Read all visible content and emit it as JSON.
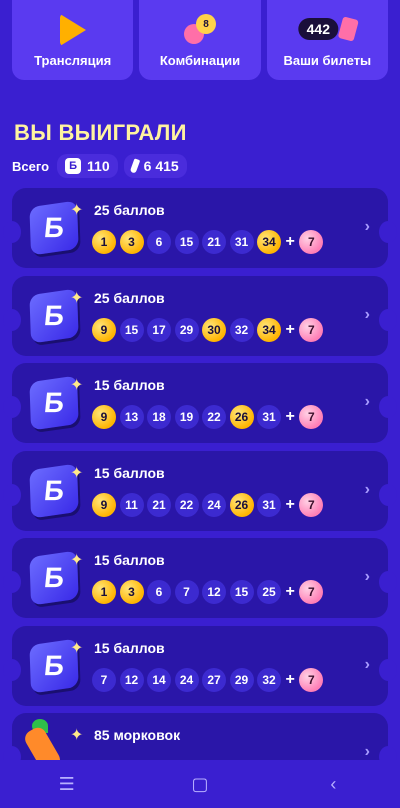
{
  "top_tabs": [
    {
      "label": "Трансляция",
      "icon": "play-icon"
    },
    {
      "label": "Комбинации",
      "icon": "lottery-balls-icon",
      "ball_number": "8"
    },
    {
      "label": "Ваши билеты",
      "icon": "tickets-icon",
      "count": "442"
    }
  ],
  "section_title": "ВЫ ВЫИГРАЛИ",
  "totals": {
    "label": "Всего",
    "points_icon": "Б",
    "points": "110",
    "carrots": "6 415"
  },
  "colors": {
    "background": "#3a1fd0",
    "card": "#2a16a8",
    "hit_ball": "#ffb400",
    "bonus_ball": "#ff7eb6",
    "title": "#fff3a0"
  },
  "cards": [
    {
      "title": "25 баллов",
      "logo": "Б",
      "balls": [
        {
          "n": "1",
          "hit": true
        },
        {
          "n": "3",
          "hit": true
        },
        {
          "n": "6"
        },
        {
          "n": "15"
        },
        {
          "n": "21"
        },
        {
          "n": "31"
        },
        {
          "n": "34",
          "hit": true
        }
      ],
      "bonus": "7"
    },
    {
      "title": "25 баллов",
      "logo": "Б",
      "balls": [
        {
          "n": "9",
          "hit": true
        },
        {
          "n": "15"
        },
        {
          "n": "17"
        },
        {
          "n": "29"
        },
        {
          "n": "30",
          "hit": true
        },
        {
          "n": "32"
        },
        {
          "n": "34",
          "hit": true
        }
      ],
      "bonus": "7"
    },
    {
      "title": "15 баллов",
      "logo": "Б",
      "balls": [
        {
          "n": "9",
          "hit": true
        },
        {
          "n": "13"
        },
        {
          "n": "18"
        },
        {
          "n": "19"
        },
        {
          "n": "22"
        },
        {
          "n": "26",
          "hit": true
        },
        {
          "n": "31"
        }
      ],
      "bonus": "7"
    },
    {
      "title": "15 баллов",
      "logo": "Б",
      "balls": [
        {
          "n": "9",
          "hit": true
        },
        {
          "n": "11"
        },
        {
          "n": "21"
        },
        {
          "n": "22"
        },
        {
          "n": "24"
        },
        {
          "n": "26",
          "hit": true
        },
        {
          "n": "31"
        }
      ],
      "bonus": "7"
    },
    {
      "title": "15 баллов",
      "logo": "Б",
      "balls": [
        {
          "n": "1",
          "hit": true
        },
        {
          "n": "3",
          "hit": true
        },
        {
          "n": "6"
        },
        {
          "n": "7"
        },
        {
          "n": "12"
        },
        {
          "n": "15"
        },
        {
          "n": "25"
        }
      ],
      "bonus": "7"
    },
    {
      "title": "15 баллов",
      "logo": "Б",
      "balls": [
        {
          "n": "7"
        },
        {
          "n": "12"
        },
        {
          "n": "14"
        },
        {
          "n": "24"
        },
        {
          "n": "27"
        },
        {
          "n": "29"
        },
        {
          "n": "32"
        }
      ],
      "bonus": "7"
    },
    {
      "title": "85 морковок",
      "logo": "carrot",
      "balls": [],
      "bonus": ""
    }
  ],
  "nav": [
    {
      "icon": "menu-icon",
      "glyph": "☰"
    },
    {
      "icon": "home-icon",
      "glyph": "▢"
    },
    {
      "icon": "back-icon",
      "glyph": "‹"
    }
  ]
}
